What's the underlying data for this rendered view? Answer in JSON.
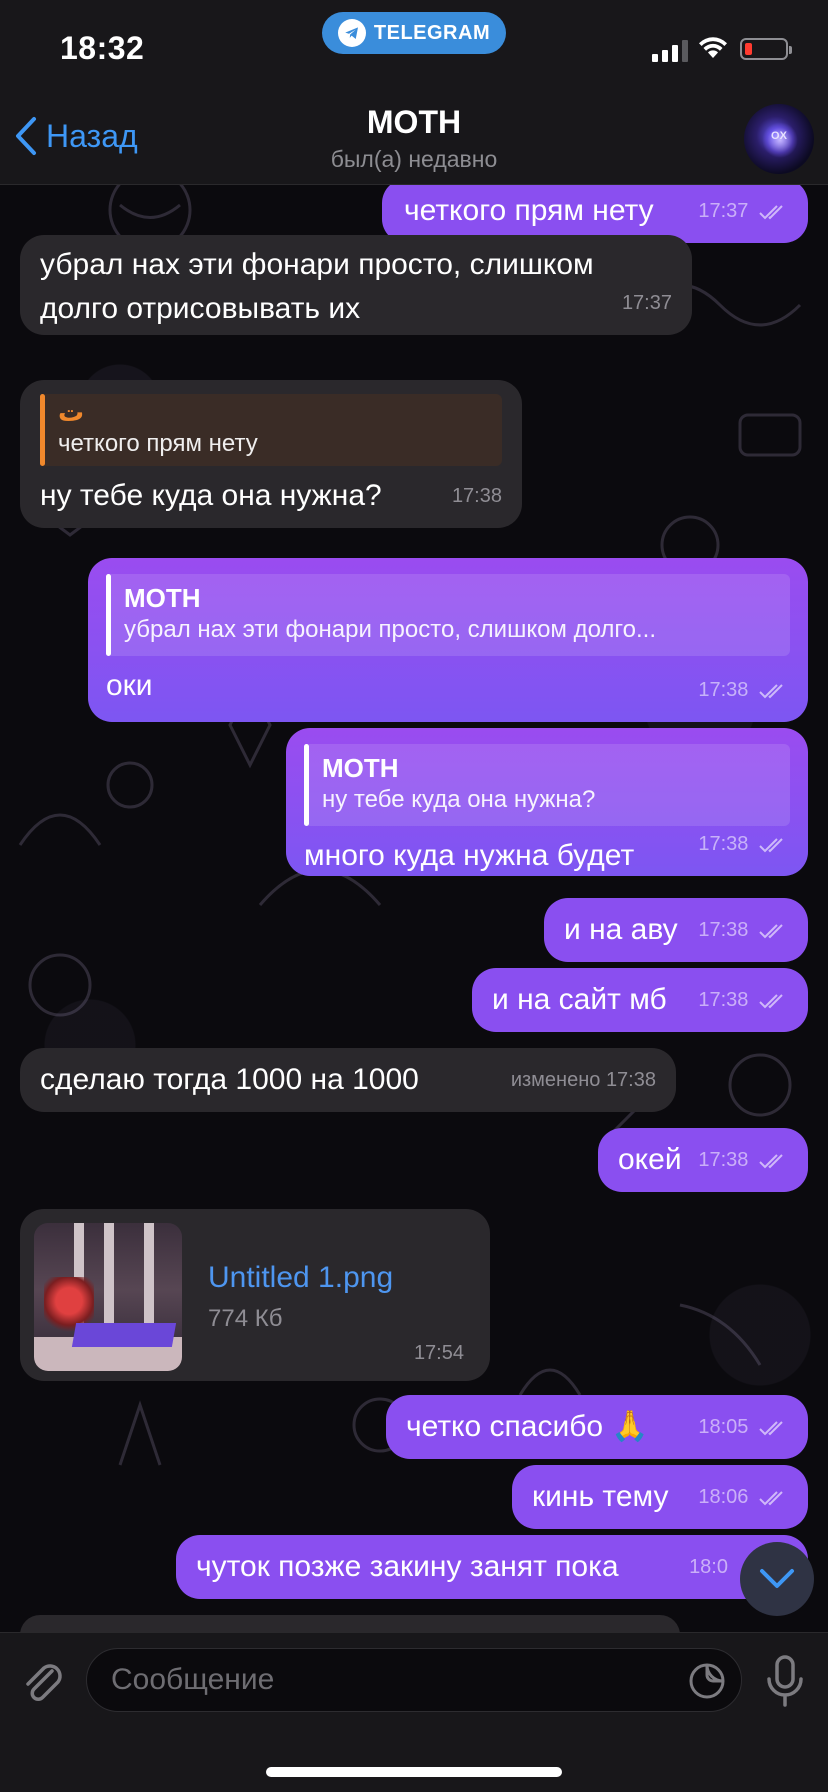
{
  "status_bar": {
    "time": "18:32",
    "pill_label": "TELEGRAM"
  },
  "header": {
    "back_label": "Назад",
    "title": "MOTH",
    "subtitle": "был(а) недавно",
    "avatar_text": "OX"
  },
  "messages": [
    {
      "dir": "out",
      "text": "четкого прям нету",
      "time": "17:37"
    },
    {
      "dir": "in",
      "text": "убрал нах эти фонари просто, слишком долго отрисовывать их",
      "time": "17:37"
    },
    {
      "dir": "in",
      "reply_name": "ت",
      "reply_text": "четкого прям нету",
      "text": "ну тебе куда она нужна?",
      "time": "17:38"
    },
    {
      "dir": "out",
      "reply_name": "MOTH",
      "reply_text": "убрал нах эти фонари просто, слишком долго...",
      "text": "оки",
      "time": "17:38"
    },
    {
      "dir": "out",
      "reply_name": "MOTH",
      "reply_text": "ну тебе куда она нужна?",
      "text": "много куда нужна будет",
      "time": "17:38"
    },
    {
      "dir": "out",
      "text": "и на аву",
      "time": "17:38"
    },
    {
      "dir": "out",
      "text": "и на сайт мб",
      "time": "17:38"
    },
    {
      "dir": "in",
      "text": "сделаю тогда 1000 на 1000",
      "edited": "изменено",
      "time": "17:38"
    },
    {
      "dir": "out",
      "text": "окей",
      "time": "17:38"
    },
    {
      "dir": "in",
      "type": "file",
      "file_name": "Untitled 1.png",
      "file_size": "774 Кб",
      "time": "17:54"
    },
    {
      "dir": "out",
      "text": "четко спасибо 🙏",
      "time": "18:05"
    },
    {
      "dir": "out",
      "text": "кинь тему",
      "time": "18:06"
    },
    {
      "dir": "out",
      "text": "чуток позже закину занят пока",
      "time": "18:0"
    }
  ],
  "input": {
    "placeholder": "Сообщение"
  },
  "colors": {
    "accent_blue": "#3e97f5",
    "outgoing_bubble": "#8a4ff0",
    "incoming_bubble": "#2a282c",
    "reply_bar_incoming": "#f0882c"
  },
  "icons": [
    "telegram-icon",
    "back-chevron-icon",
    "attach-icon",
    "sticker-icon",
    "mic-icon",
    "chevron-down-icon",
    "read-checks-icon"
  ]
}
